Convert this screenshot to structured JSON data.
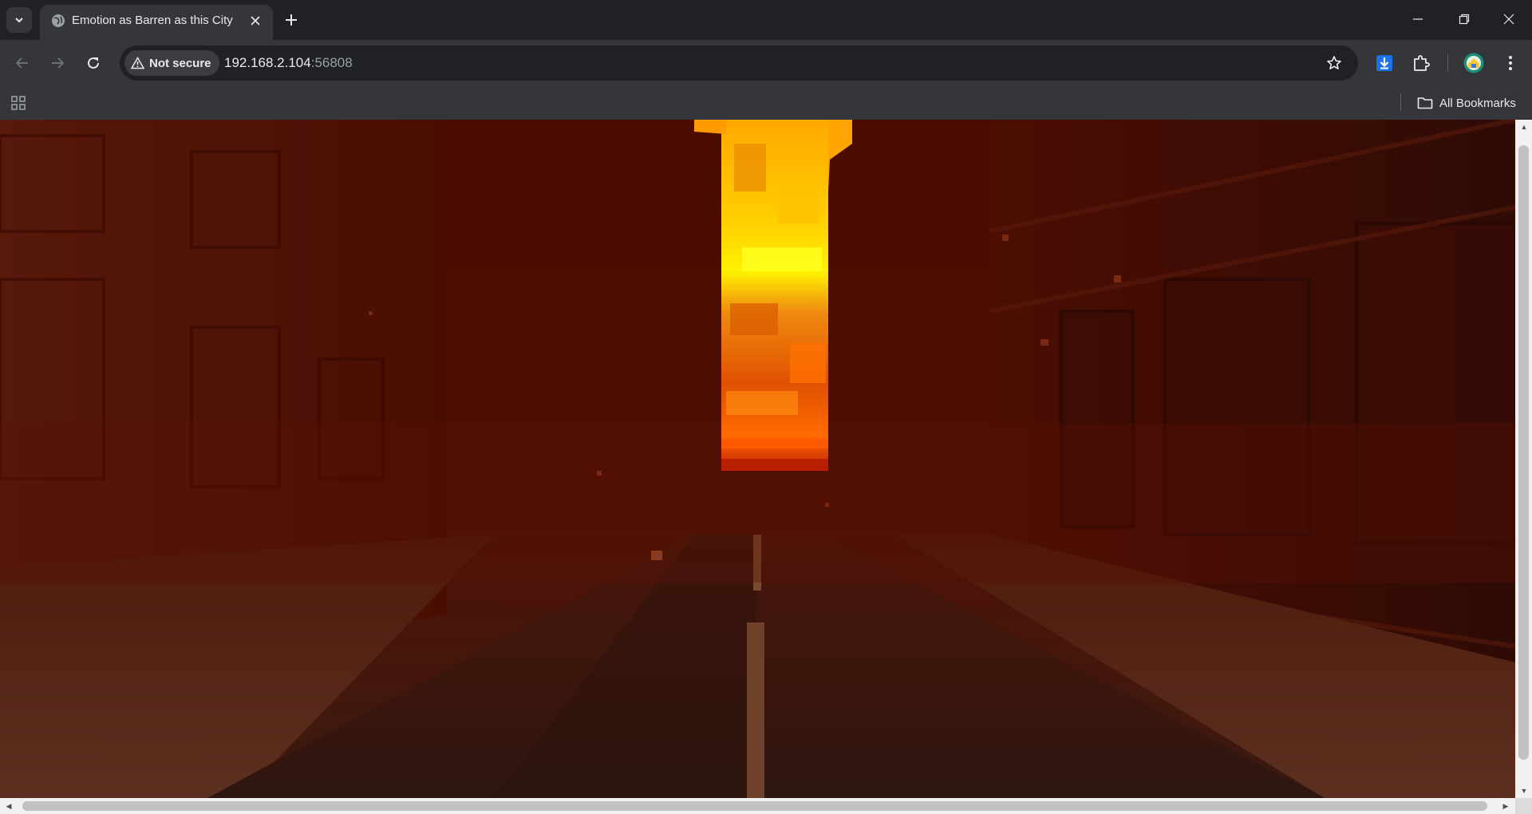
{
  "browser": {
    "tab_title": "Emotion as Barren as this City",
    "security_chip": "Not secure",
    "url_host": "192.168.2.104",
    "url_port": ":56808",
    "bookmarks_label": "All Bookmarks"
  },
  "icons": {
    "tab_search": "chevron-down-icon",
    "favicon": "globe-icon",
    "tab_close": "close-icon",
    "new_tab": "plus-icon",
    "minimize": "minimize-icon",
    "restore": "restore-icon",
    "window_close": "close-icon",
    "back": "arrow-left-icon",
    "forward": "arrow-right-icon",
    "reload": "reload-icon",
    "warning": "warning-icon",
    "bookmark_star": "star-icon",
    "download": "download-icon",
    "extensions": "puzzle-icon",
    "profile": "avatar",
    "menu": "kebab-menu-icon",
    "apps": "apps-grid-icon",
    "folder": "folder-icon"
  },
  "scene": {
    "description_colors": {
      "sky": "#4a0c02",
      "fog": "#5a1408",
      "road": "#3a1408",
      "sidewalk": "#5a2a1c",
      "fire_light": "#ffcc00",
      "fire_mid": "#ff8a00",
      "fire_dark": "#d83a00"
    }
  }
}
